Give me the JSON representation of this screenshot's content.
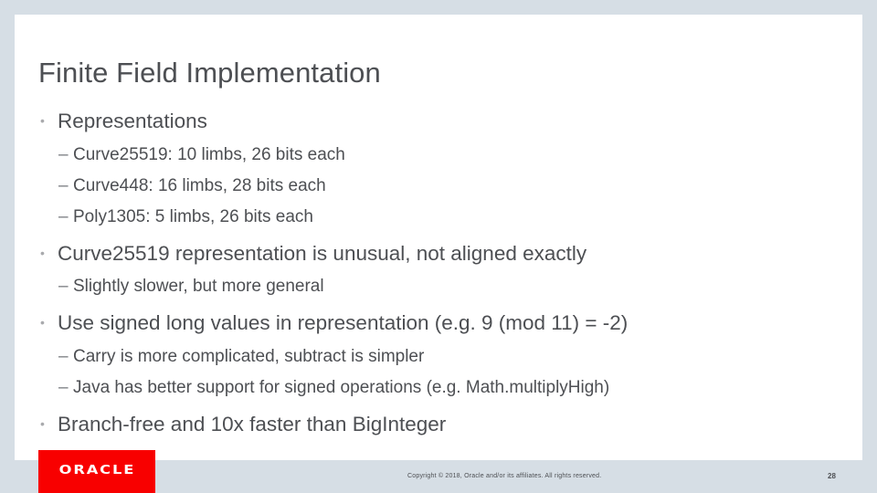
{
  "slide": {
    "title": "Finite Field Implementation",
    "bullets": [
      {
        "text": "Representations",
        "sub": [
          "Curve25519: 10 limbs, 26 bits each",
          "Curve448: 16 limbs, 28 bits each",
          "Poly1305: 5 limbs, 26 bits each"
        ]
      },
      {
        "text": "Curve25519 representation is unusual, not aligned exactly",
        "sub": [
          "Slightly slower, but more general"
        ]
      },
      {
        "text": "Use signed long values in representation (e.g. 9 (mod 11) = -2)",
        "sub": [
          "Carry is more complicated, subtract is simpler",
          "Java has better support for signed operations (e.g. Math.multiplyHigh)"
        ]
      },
      {
        "text": "Branch-free and 10x faster than BigInteger",
        "sub": []
      }
    ],
    "bullet_glyph": "•",
    "sub_glyph": "–"
  },
  "footer": {
    "logo_text": "ORACLE",
    "logo_color": "#f80000",
    "copyright": "Copyright © 2018, Oracle and/or its affiliates. All rights reserved.",
    "page_number": "28"
  }
}
